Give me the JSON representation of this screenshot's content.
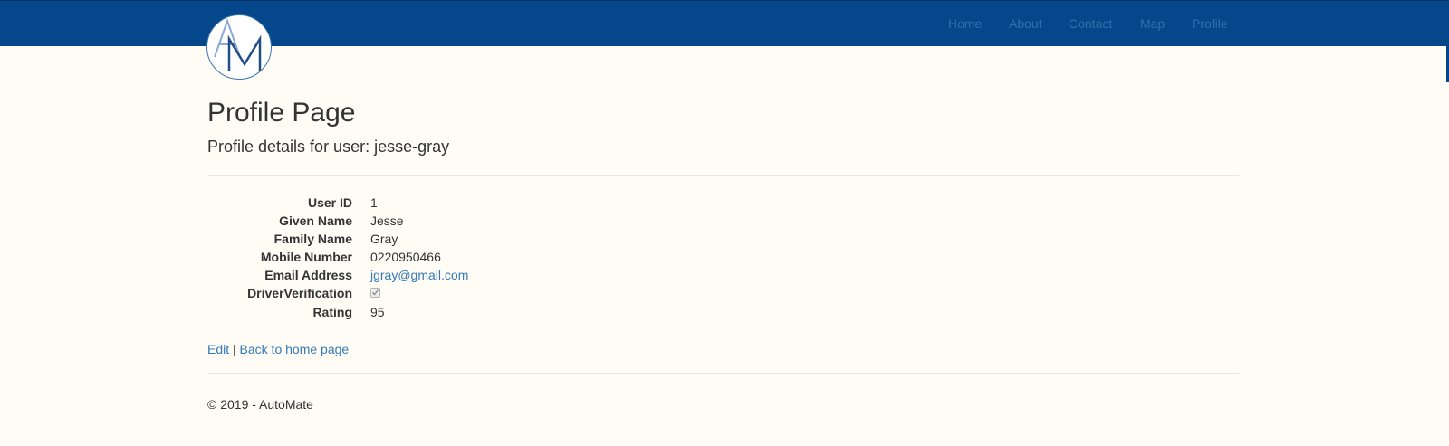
{
  "nav": {
    "logo_letters": "AM",
    "links": [
      "Home",
      "About",
      "Contact",
      "Map",
      "Profile"
    ]
  },
  "header": {
    "title": "Profile Page",
    "subtitle": "Profile details for user: jesse-gray"
  },
  "profile": {
    "fields": [
      {
        "label": "User ID",
        "value": "1"
      },
      {
        "label": "Given Name",
        "value": "Jesse"
      },
      {
        "label": "Family Name",
        "value": "Gray"
      },
      {
        "label": "Mobile Number",
        "value": "0220950466"
      },
      {
        "label": "Email Address",
        "value": "jgray@gmail.com"
      },
      {
        "label": "DriverVerification",
        "checked": true
      },
      {
        "label": "Rating",
        "value": "95"
      }
    ]
  },
  "actions": {
    "edit_label": "Edit",
    "separator": "|",
    "back_label": "Back to home page"
  },
  "footer": {
    "text": "© 2019 - AutoMate"
  },
  "colors": {
    "navbar": "#04478a",
    "link": "#337ab7",
    "background": "#fffcf5"
  }
}
